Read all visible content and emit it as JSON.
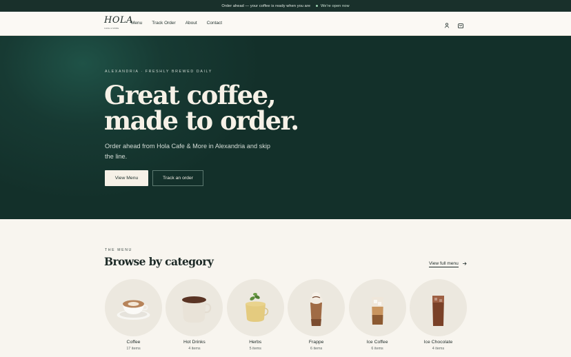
{
  "announcement": {
    "message": "Order ahead — your coffee is ready when you are",
    "status": "We're open now"
  },
  "header": {
    "logo_text": "HOLA",
    "logo_subtext": "CAFE & MORE",
    "nav": [
      "Menu",
      "Track Order",
      "About",
      "Contact"
    ],
    "icons": [
      "user-icon",
      "bag-icon"
    ]
  },
  "hero": {
    "eyebrow": "ALEXANDRIA · FRESHLY BREWED DAILY",
    "headline_line1": "Great coffee,",
    "headline_line2": "made to order.",
    "subcopy": "Order ahead from Hola Cafe & More in Alexandria and skip the line.",
    "primary_cta": "View Menu",
    "secondary_cta": "Track an order"
  },
  "menu_section": {
    "eyebrow": "THE MENU",
    "title": "Browse by category",
    "view_all": "View full menu",
    "categories": [
      {
        "name": "Coffee",
        "count": "17 items"
      },
      {
        "name": "Hot Drinks",
        "count": "4 items"
      },
      {
        "name": "Herbs",
        "count": "5 items"
      },
      {
        "name": "Frappe",
        "count": "6 items"
      },
      {
        "name": "Ice Coffee",
        "count": "6 items"
      },
      {
        "name": "Ice Chocolate",
        "count": "4 items"
      }
    ]
  },
  "colors": {
    "hero_bg": "#173a33",
    "announcement_bg": "#19302b",
    "cream": "#f8f5ef",
    "open_dot": "#9ad3b0"
  }
}
